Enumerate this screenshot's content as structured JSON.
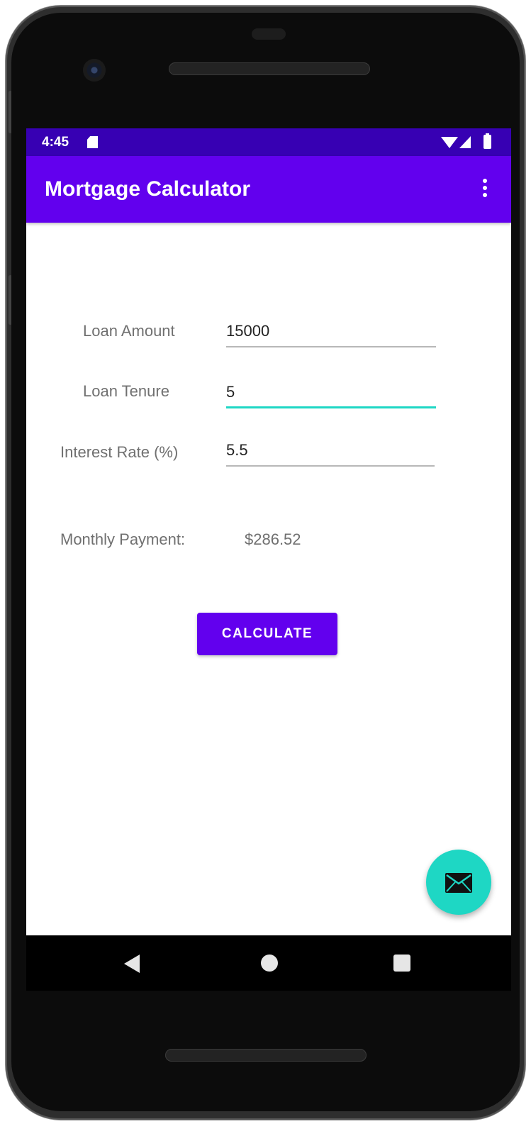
{
  "status_bar": {
    "time": "4:45"
  },
  "app_bar": {
    "title": "Mortgage Calculator"
  },
  "form": {
    "loan_amount": {
      "label": "Loan Amount",
      "value": "15000"
    },
    "loan_tenure": {
      "label": "Loan Tenure",
      "value": "5"
    },
    "interest_rate": {
      "label": "Interest Rate (%)",
      "value": "5.5"
    }
  },
  "result": {
    "label": "Monthly Payment:",
    "value": "$286.52"
  },
  "calculate_button": {
    "label": "CALCULATE"
  },
  "icons": {
    "fab": "mail-icon",
    "overflow": "more-vert-icon",
    "nav": [
      "back-icon",
      "home-icon",
      "recents-icon"
    ]
  },
  "colors": {
    "primary": "#6200ee",
    "primary_dark": "#3700b3",
    "accent": "#1ed7c4"
  }
}
